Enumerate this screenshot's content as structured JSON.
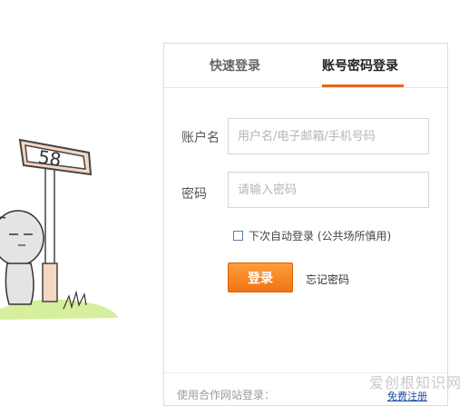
{
  "illustration": {
    "sign_text": "58"
  },
  "tabs": {
    "quick_login": "快速登录",
    "account_login": "账号密码登录"
  },
  "form": {
    "username_label": "账户名",
    "username_placeholder": "用户名/电子邮箱/手机号码",
    "password_label": "密码",
    "password_placeholder": "请输入密码",
    "remember_label": "下次自动登录 (公共场所慎用)",
    "remember_checked": false,
    "login_button": "登录",
    "forgot_password": "忘记密码"
  },
  "footer": {
    "partner_login": "使用合作网站登录：",
    "register": "免费注册"
  },
  "watermark": "爱创根知识网",
  "colors": {
    "accent": "#e8641b",
    "button_top": "#ff9d3a",
    "button_bottom": "#f07414"
  }
}
